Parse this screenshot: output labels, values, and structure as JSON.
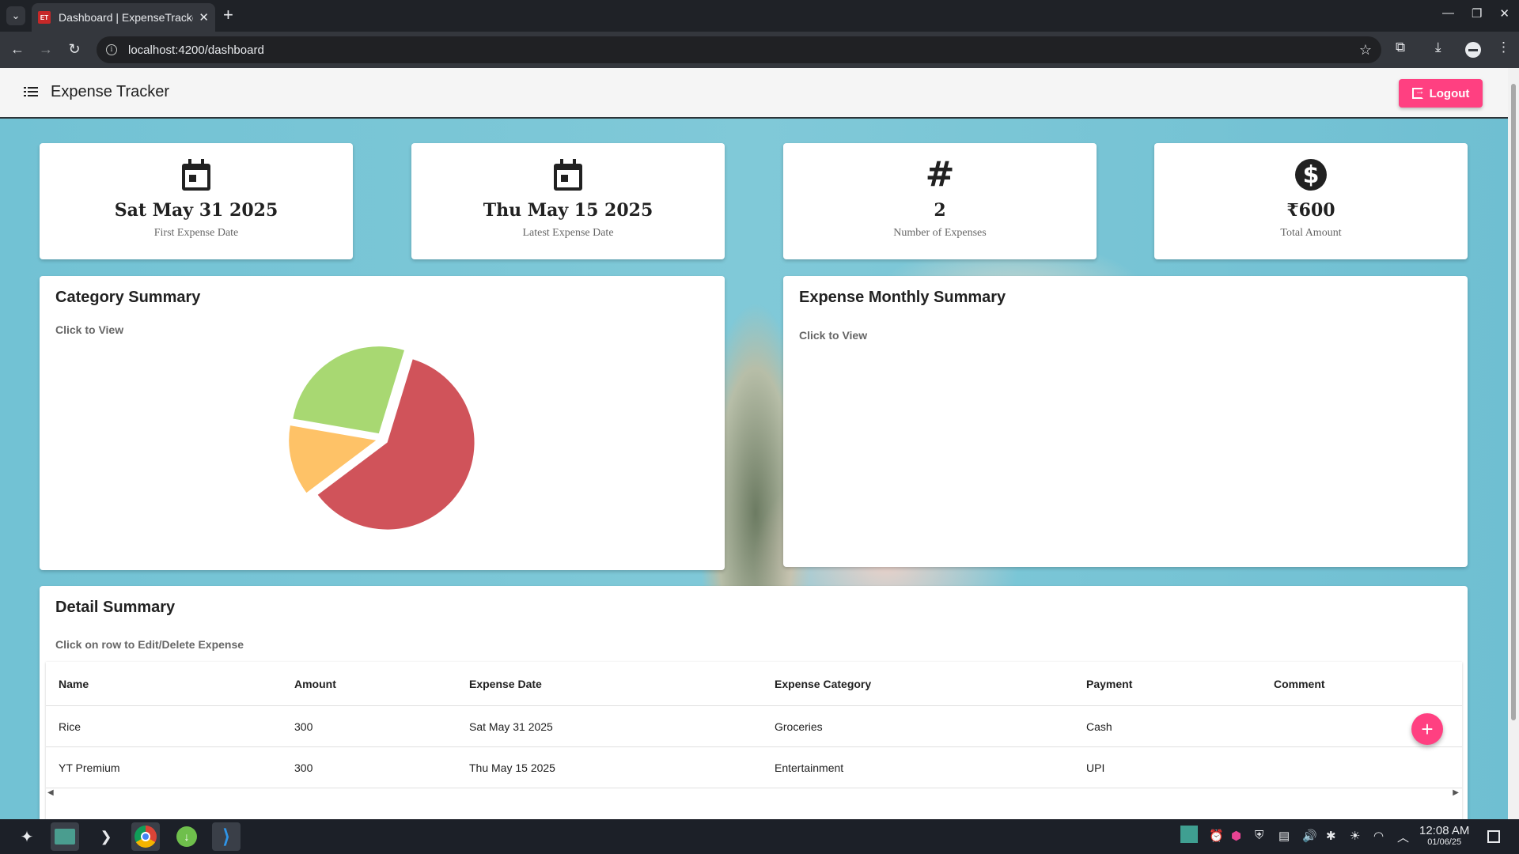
{
  "browser": {
    "tab_title": "Dashboard | ExpenseTracker",
    "favicon_text": "ET",
    "url": "localhost:4200/dashboard"
  },
  "app": {
    "title": "Expense Tracker",
    "logout_label": "Logout"
  },
  "stats": [
    {
      "value": "Sat May 31 2025",
      "label": "First Expense Date",
      "icon": "calendar-icon"
    },
    {
      "value": "Thu May 15 2025",
      "label": "Latest Expense Date",
      "icon": "calendar-icon"
    },
    {
      "value": "2",
      "label": "Number of Expenses",
      "icon": "hash-icon"
    },
    {
      "value": "₹600",
      "label": "Total Amount",
      "icon": "dollar-icon"
    }
  ],
  "category_summary": {
    "title": "Category Summary",
    "hint": "Click to View"
  },
  "chart_data": {
    "type": "pie",
    "values": [
      60,
      13,
      27
    ],
    "colors": [
      "#d0535a",
      "#fec267",
      "#a8d872"
    ]
  },
  "monthly_summary": {
    "title": "Expense Monthly Summary",
    "hint": "Click to View"
  },
  "detail_summary": {
    "title": "Detail Summary",
    "hint": "Click on row to Edit/Delete Expense",
    "columns": [
      "Name",
      "Amount",
      "Expense Date",
      "Expense Category",
      "Payment",
      "Comment"
    ],
    "rows": [
      [
        "Rice",
        "300",
        "Sat May 31 2025",
        "Groceries",
        "Cash",
        ""
      ],
      [
        "YT Premium",
        "300",
        "Thu May 15 2025",
        "Entertainment",
        "UPI",
        ""
      ]
    ],
    "add_button": "+"
  },
  "taskbar": {
    "time": "12:08 AM",
    "date": "01/06/25"
  },
  "colors": {
    "accent": "#ff4081",
    "header_bg": "#f5f5f5",
    "page_bg": "#75c2d3"
  }
}
